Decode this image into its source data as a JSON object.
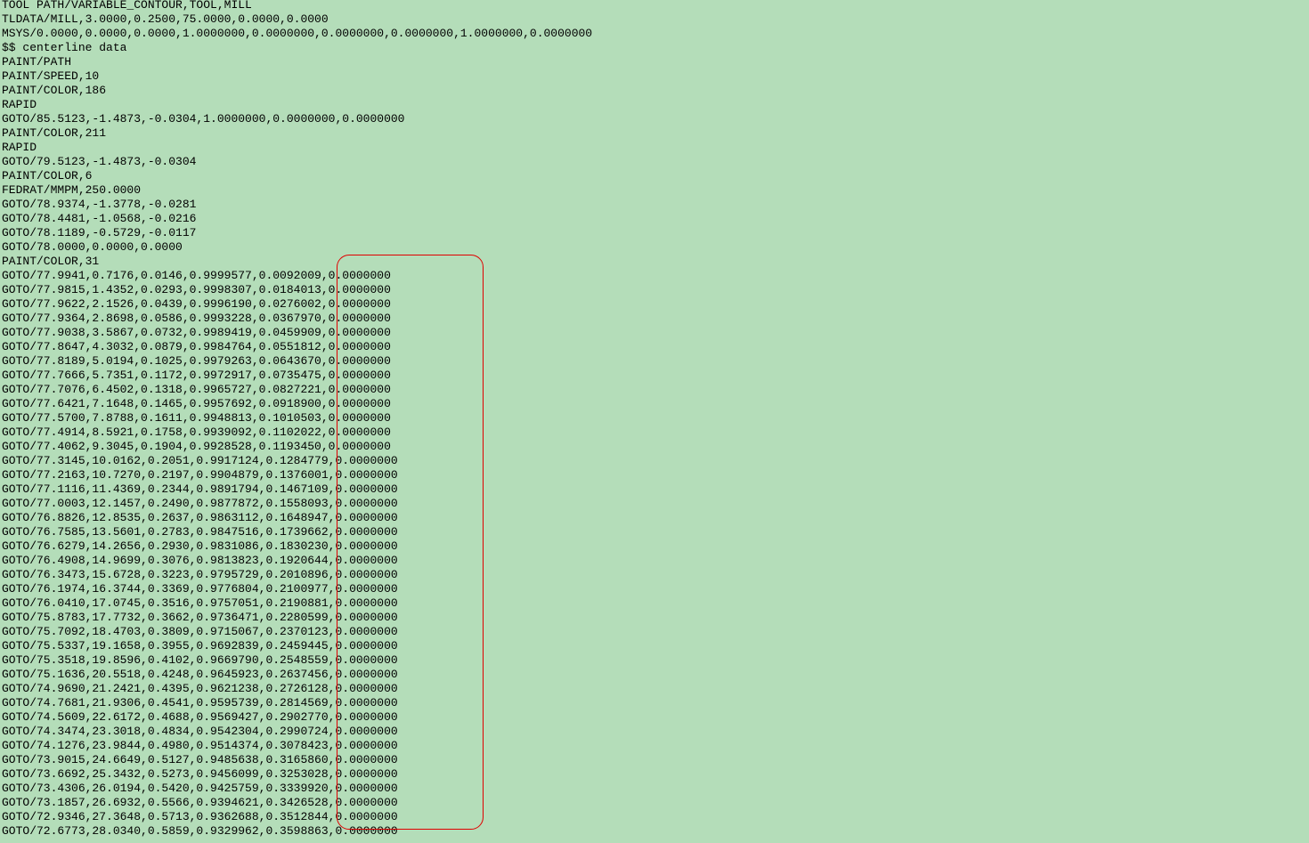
{
  "colors": {
    "background": "#b4ddb9",
    "text": "#000000",
    "highlight": "#e00000"
  },
  "lines": [
    "TOOL PATH/VARIABLE_CONTOUR,TOOL,MILL",
    "TLDATA/MILL,3.0000,0.2500,75.0000,0.0000,0.0000",
    "MSYS/0.0000,0.0000,0.0000,1.0000000,0.0000000,0.0000000,0.0000000,1.0000000,0.0000000",
    "$$ centerline data",
    "PAINT/PATH",
    "PAINT/SPEED,10",
    "PAINT/COLOR,186",
    "RAPID",
    "GOTO/85.5123,-1.4873,-0.0304,1.0000000,0.0000000,0.0000000",
    "PAINT/COLOR,211",
    "RAPID",
    "GOTO/79.5123,-1.4873,-0.0304",
    "PAINT/COLOR,6",
    "FEDRAT/MMPM,250.0000",
    "GOTO/78.9374,-1.3778,-0.0281",
    "GOTO/78.4481,-1.0568,-0.0216",
    "GOTO/78.1189,-0.5729,-0.0117",
    "GOTO/78.0000,0.0000,0.0000",
    "PAINT/COLOR,31",
    "GOTO/77.9941,0.7176,0.0146,0.9999577,0.0092009,0.0000000",
    "GOTO/77.9815,1.4352,0.0293,0.9998307,0.0184013,0.0000000",
    "GOTO/77.9622,2.1526,0.0439,0.9996190,0.0276002,0.0000000",
    "GOTO/77.9364,2.8698,0.0586,0.9993228,0.0367970,0.0000000",
    "GOTO/77.9038,3.5867,0.0732,0.9989419,0.0459909,0.0000000",
    "GOTO/77.8647,4.3032,0.0879,0.9984764,0.0551812,0.0000000",
    "GOTO/77.8189,5.0194,0.1025,0.9979263,0.0643670,0.0000000",
    "GOTO/77.7666,5.7351,0.1172,0.9972917,0.0735475,0.0000000",
    "GOTO/77.7076,6.4502,0.1318,0.9965727,0.0827221,0.0000000",
    "GOTO/77.6421,7.1648,0.1465,0.9957692,0.0918900,0.0000000",
    "GOTO/77.5700,7.8788,0.1611,0.9948813,0.1010503,0.0000000",
    "GOTO/77.4914,8.5921,0.1758,0.9939092,0.1102022,0.0000000",
    "GOTO/77.4062,9.3045,0.1904,0.9928528,0.1193450,0.0000000",
    "GOTO/77.3145,10.0162,0.2051,0.9917124,0.1284779,0.0000000",
    "GOTO/77.2163,10.7270,0.2197,0.9904879,0.1376001,0.0000000",
    "GOTO/77.1116,11.4369,0.2344,0.9891794,0.1467109,0.0000000",
    "GOTO/77.0003,12.1457,0.2490,0.9877872,0.1558093,0.0000000",
    "GOTO/76.8826,12.8535,0.2637,0.9863112,0.1648947,0.0000000",
    "GOTO/76.7585,13.5601,0.2783,0.9847516,0.1739662,0.0000000",
    "GOTO/76.6279,14.2656,0.2930,0.9831086,0.1830230,0.0000000",
    "GOTO/76.4908,14.9699,0.3076,0.9813823,0.1920644,0.0000000",
    "GOTO/76.3473,15.6728,0.3223,0.9795729,0.2010896,0.0000000",
    "GOTO/76.1974,16.3744,0.3369,0.9776804,0.2100977,0.0000000",
    "GOTO/76.0410,17.0745,0.3516,0.9757051,0.2190881,0.0000000",
    "GOTO/75.8783,17.7732,0.3662,0.9736471,0.2280599,0.0000000",
    "GOTO/75.7092,18.4703,0.3809,0.9715067,0.2370123,0.0000000",
    "GOTO/75.5337,19.1658,0.3955,0.9692839,0.2459445,0.0000000",
    "GOTO/75.3518,19.8596,0.4102,0.9669790,0.2548559,0.0000000",
    "GOTO/75.1636,20.5518,0.4248,0.9645923,0.2637456,0.0000000",
    "GOTO/74.9690,21.2421,0.4395,0.9621238,0.2726128,0.0000000",
    "GOTO/74.7681,21.9306,0.4541,0.9595739,0.2814569,0.0000000",
    "GOTO/74.5609,22.6172,0.4688,0.9569427,0.2902770,0.0000000",
    "GOTO/74.3474,23.3018,0.4834,0.9542304,0.2990724,0.0000000",
    "GOTO/74.1276,23.9844,0.4980,0.9514374,0.3078423,0.0000000",
    "GOTO/73.9015,24.6649,0.5127,0.9485638,0.3165860,0.0000000",
    "GOTO/73.6692,25.3432,0.5273,0.9456099,0.3253028,0.0000000",
    "GOTO/73.4306,26.0194,0.5420,0.9425759,0.3339920,0.0000000",
    "GOTO/73.1857,26.6932,0.5566,0.9394621,0.3426528,0.0000000",
    "GOTO/72.9346,27.3648,0.5713,0.9362688,0.3512844,0.0000000",
    "GOTO/72.6773,28.0340,0.5859,0.9329962,0.3598863,0.0000000"
  ]
}
